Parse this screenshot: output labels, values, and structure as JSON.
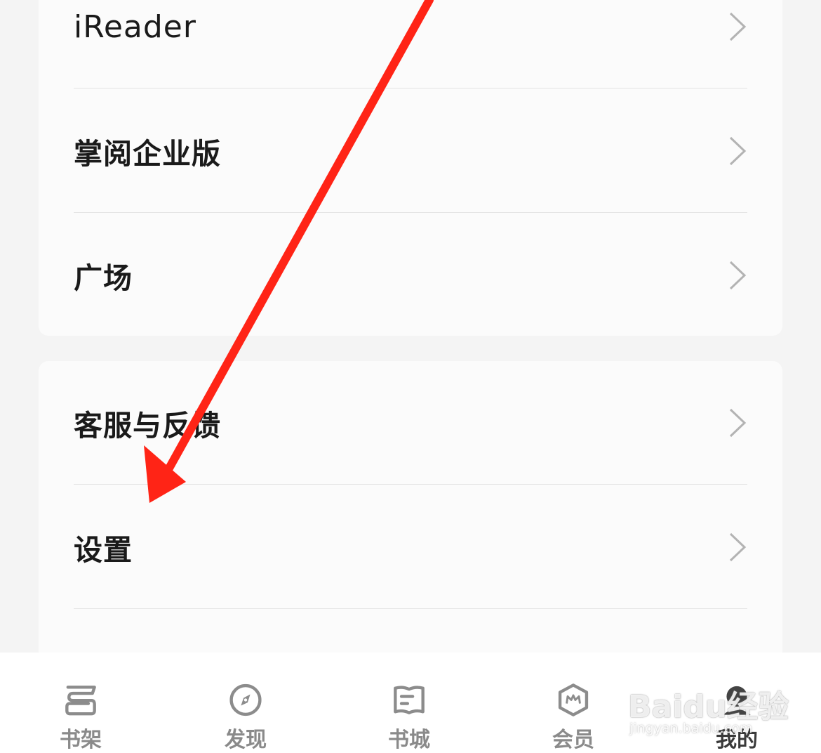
{
  "menu_group_1": {
    "items": [
      {
        "label": "iReader"
      },
      {
        "label": "掌阅企业版"
      },
      {
        "label": "广场"
      }
    ]
  },
  "menu_group_2": {
    "items": [
      {
        "label": "客服与反馈"
      },
      {
        "label": "设置"
      }
    ]
  },
  "tab_bar": {
    "tabs": [
      {
        "label": "书架",
        "icon": "bookshelf-icon"
      },
      {
        "label": "发现",
        "icon": "compass-icon"
      },
      {
        "label": "书城",
        "icon": "bookstore-icon"
      },
      {
        "label": "会员",
        "icon": "membership-icon"
      },
      {
        "label": "我的",
        "icon": "profile-icon"
      }
    ]
  },
  "annotation": {
    "color": "#ff2416"
  },
  "watermark": {
    "main": "Baidu经验",
    "sub": "jingyan.baidu.com"
  }
}
